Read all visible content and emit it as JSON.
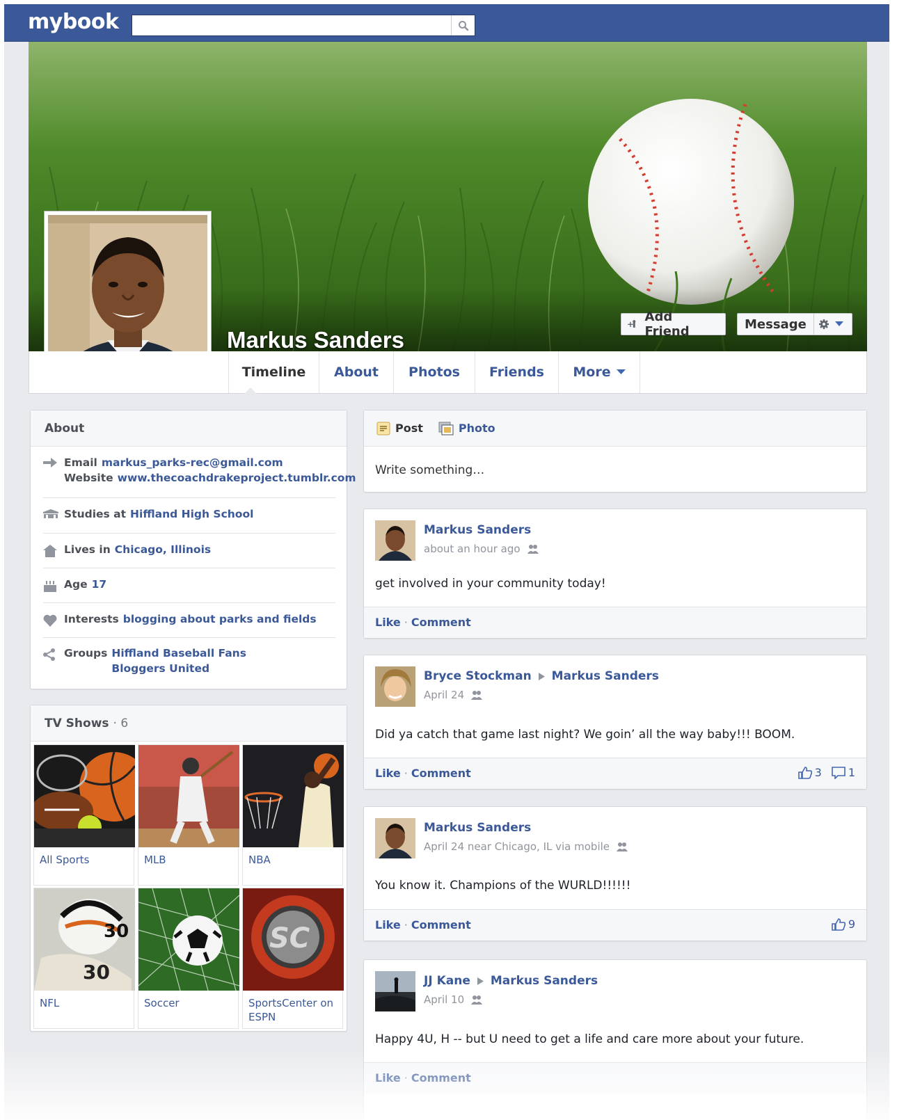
{
  "topbar": {
    "logo": "mybook",
    "search_placeholder": "",
    "search_icon": "magnifier-icon",
    "bg_color": "#3b5998"
  },
  "profile": {
    "name": "Markus Sanders",
    "cover_image": "baseball-in-grass",
    "add_friend_label": "Add Friend",
    "message_label": "Message"
  },
  "nav": {
    "tabs": [
      {
        "label": "Timeline",
        "active": true
      },
      {
        "label": "About"
      },
      {
        "label": "Photos"
      },
      {
        "label": "Friends"
      },
      {
        "label": "More"
      }
    ]
  },
  "about": {
    "title": "About",
    "email_label": "Email",
    "email": "markus_parks-rec@gmail.com",
    "website_label": "Website",
    "website": "www.thecoachdrakeproject.tumblr.com",
    "studies_label": "Studies at",
    "studies": "Hiffland High School",
    "lives_label": "Lives in",
    "lives": "Chicago, Illinois",
    "age_label": "Age",
    "age": "17",
    "interests_label": "Interests",
    "interests": "blogging about parks and fields",
    "groups_label": "Groups",
    "groups": [
      "Hiffland Baseball Fans",
      "Bloggers United"
    ]
  },
  "tv_shows": {
    "title": "TV Shows",
    "count": "· 6",
    "items": [
      {
        "label": "All Sports"
      },
      {
        "label": "MLB"
      },
      {
        "label": "NBA"
      },
      {
        "label": "NFL"
      },
      {
        "label": "Soccer"
      },
      {
        "label": "SportsCenter on ESPN"
      }
    ]
  },
  "composer": {
    "post_label": "Post",
    "photo_label": "Photo",
    "placeholder": "Write something…"
  },
  "posts": [
    {
      "author": "Markus Sanders",
      "target": "",
      "meta": "about an hour ago",
      "text": "get involved in your community today!",
      "like": "Like",
      "comment": "Comment",
      "likes": "",
      "comments": ""
    },
    {
      "author": "Bryce Stockman",
      "target": "Markus Sanders",
      "meta": "April 24",
      "text": "Did ya catch that game last night? We goin’ all the way baby!!! BOOM.",
      "like": "Like",
      "comment": "Comment",
      "likes": "3",
      "comments": "1"
    },
    {
      "author": "Markus Sanders",
      "target": "",
      "meta": "April 24 near Chicago, IL via mobile",
      "text": "You know it. Champions of the WURLD!!!!!!",
      "like": "Like",
      "comment": "Comment",
      "likes": "9",
      "comments": ""
    },
    {
      "author": "JJ Kane",
      "target": "Markus Sanders",
      "meta": "April 10",
      "text": "Happy 4U, H -- but U need to get a life and care more about your future.",
      "like": "Like",
      "comment": "Comment",
      "likes": "",
      "comments": ""
    }
  ],
  "colors": {
    "brand": "#3b5998",
    "background": "#e9eaed",
    "link": "#3b5998"
  }
}
